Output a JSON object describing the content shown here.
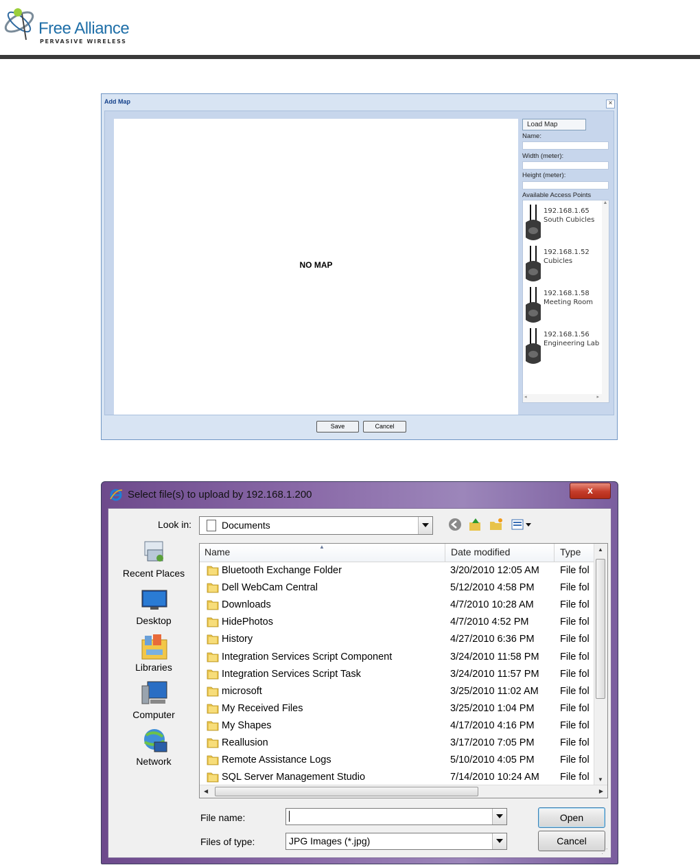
{
  "header": {
    "brand": "Free Alliance",
    "tagline": "PERVASIVE WIRELESS"
  },
  "add_map": {
    "title": "Add Map",
    "placeholder": "NO MAP",
    "load_map_label": "Load Map",
    "name_label": "Name:",
    "width_label": "Width (meter):",
    "height_label": "Height (meter):",
    "access_points_label": "Available Access Points",
    "access_points": [
      {
        "ip": "192.168.1.65",
        "location": "South Cubicles"
      },
      {
        "ip": "192.168.1.52",
        "location": "Cubicles"
      },
      {
        "ip": "192.168.1.58",
        "location": "Meeting Room"
      },
      {
        "ip": "192.168.1.56",
        "location": "Engineering Lab"
      }
    ],
    "save_label": "Save",
    "cancel_label": "Cancel"
  },
  "file_dialog": {
    "title": "Select file(s) to upload by 192.168.1.200",
    "close_label": "x",
    "look_in_label": "Look in:",
    "look_in_value": "Documents",
    "places": [
      "Recent Places",
      "Desktop",
      "Libraries",
      "Computer",
      "Network"
    ],
    "columns": {
      "name": "Name",
      "date": "Date modified",
      "type": "Type"
    },
    "files": [
      {
        "name": "Bluetooth Exchange Folder",
        "date": "3/20/2010 12:05 AM",
        "type": "File fol"
      },
      {
        "name": "Dell WebCam Central",
        "date": "5/12/2010 4:58 PM",
        "type": "File fol"
      },
      {
        "name": "Downloads",
        "date": "4/7/2010 10:28 AM",
        "type": "File fol"
      },
      {
        "name": "HidePhotos",
        "date": "4/7/2010 4:52 PM",
        "type": "File fol"
      },
      {
        "name": "History",
        "date": "4/27/2010 6:36 PM",
        "type": "File fol"
      },
      {
        "name": "Integration Services Script Component",
        "date": "3/24/2010 11:58 PM",
        "type": "File fol"
      },
      {
        "name": "Integration Services Script Task",
        "date": "3/24/2010 11:57 PM",
        "type": "File fol"
      },
      {
        "name": "microsoft",
        "date": "3/25/2010 11:02 AM",
        "type": "File fol"
      },
      {
        "name": "My Received Files",
        "date": "3/25/2010 1:04 PM",
        "type": "File fol"
      },
      {
        "name": "My Shapes",
        "date": "4/17/2010 4:16 PM",
        "type": "File fol"
      },
      {
        "name": "Reallusion",
        "date": "3/17/2010 7:05 PM",
        "type": "File fol"
      },
      {
        "name": "Remote Assistance Logs",
        "date": "5/10/2010 4:05 PM",
        "type": "File fol"
      },
      {
        "name": "SQL Server Management Studio",
        "date": "7/14/2010 10:24 AM",
        "type": "File fol"
      }
    ],
    "file_name_label": "File name:",
    "file_name_value": "",
    "file_type_label": "Files of type:",
    "file_type_value": "JPG Images (*.jpg)",
    "open_label": "Open",
    "cancel_label": "Cancel"
  }
}
